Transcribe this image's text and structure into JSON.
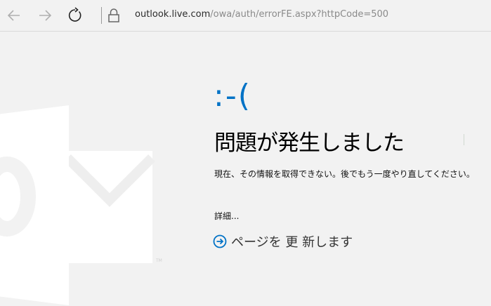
{
  "browser": {
    "url_domain": "outlook.live.com",
    "url_path": "/owa/auth/errorFE.aspx?httpCode=500"
  },
  "error": {
    "emoticon": ":-(",
    "title": "問題が発生しました",
    "description": "現在、その情報を取得できない。後でもう一度やり直してください。",
    "details_label": "詳細...",
    "refresh_label": "ページを 更 新します"
  },
  "colors": {
    "accent": "#0072c6",
    "background": "#f2f2f2"
  },
  "icons": [
    "back-arrow-icon",
    "forward-arrow-icon",
    "refresh-icon",
    "lock-icon",
    "outlook-logo",
    "circle-arrow-icon"
  ]
}
